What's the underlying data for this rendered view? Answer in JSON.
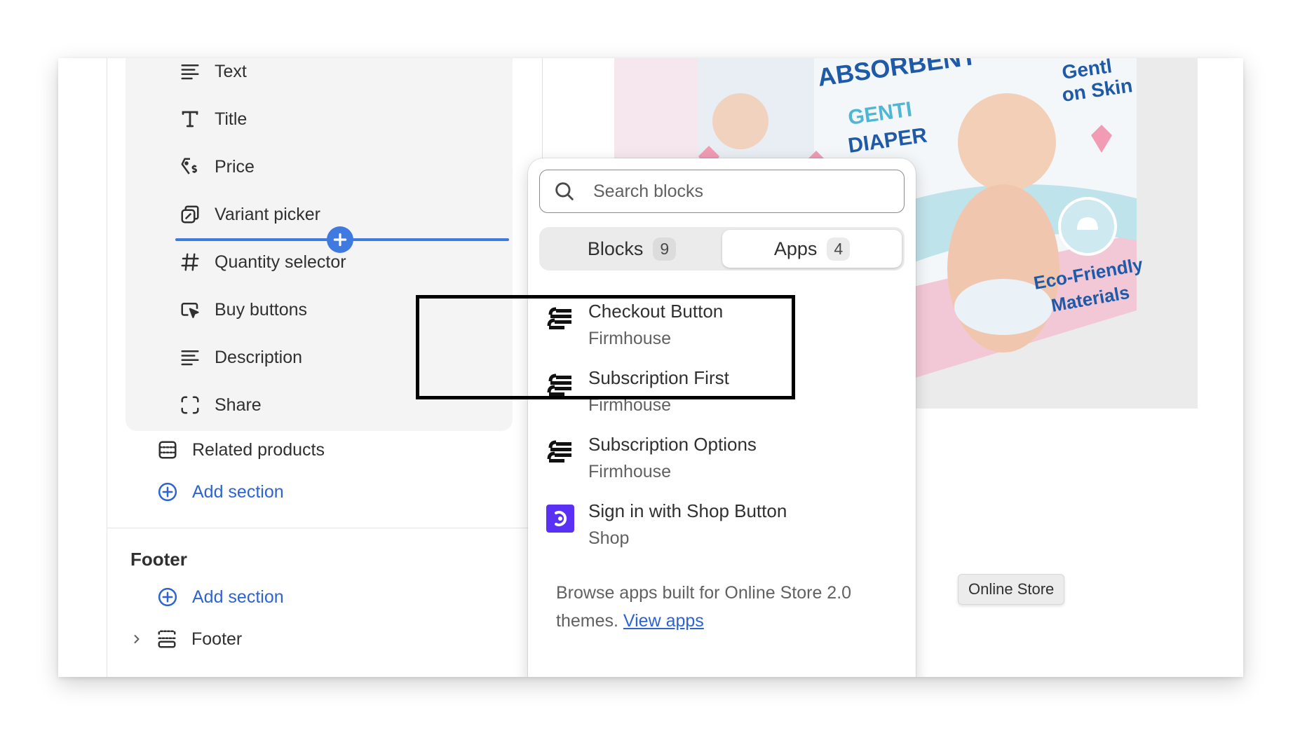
{
  "sidebar": {
    "blocks": [
      {
        "label": "Text",
        "icon": "text-lines-icon"
      },
      {
        "label": "Title",
        "icon": "title-t-icon"
      },
      {
        "label": "Price",
        "icon": "price-tag-icon"
      },
      {
        "label": "Variant picker",
        "icon": "variant-picker-icon"
      },
      {
        "label": "Quantity selector",
        "icon": "hash-icon"
      },
      {
        "label": "Buy buttons",
        "icon": "cursor-button-icon"
      },
      {
        "label": "Description",
        "icon": "text-lines-icon"
      },
      {
        "label": "Share",
        "icon": "share-frame-icon"
      }
    ],
    "related_products": "Related products",
    "add_section_1": "Add section",
    "footer_group_title": "Footer",
    "add_section_2": "Add section",
    "footer_section": "Footer"
  },
  "popover": {
    "search_placeholder": "Search blocks",
    "tabs": [
      {
        "label": "Blocks",
        "count": "9",
        "active": false
      },
      {
        "label": "Apps",
        "count": "4",
        "active": true
      }
    ],
    "apps": [
      {
        "name": "Checkout Button",
        "vendor": "Firmhouse",
        "icon": "firmhouse-logo-icon"
      },
      {
        "name": "Subscription First",
        "vendor": "Firmhouse",
        "icon": "firmhouse-logo-icon"
      },
      {
        "name": "Subscription Options",
        "vendor": "Firmhouse",
        "icon": "firmhouse-logo-icon"
      },
      {
        "name": "Sign in with Shop Button",
        "vendor": "Shop",
        "icon": "shop-logo-icon"
      }
    ],
    "browse_text": "Browse apps built for Online Store 2.0 themes.",
    "browse_link": "View apps"
  },
  "preview": {
    "product_text": [
      "ABSORBENT",
      "GENTI",
      "DIAPER",
      "Gentl",
      "on Skin",
      "Eco-Friendly",
      "Materials"
    ],
    "online_store_badge": "Online Store"
  },
  "colors": {
    "accent_blue": "#3f7ae0",
    "link_blue": "#2e63d2",
    "shop_purple": "#5a31f4",
    "highlight_border": "#000000"
  }
}
